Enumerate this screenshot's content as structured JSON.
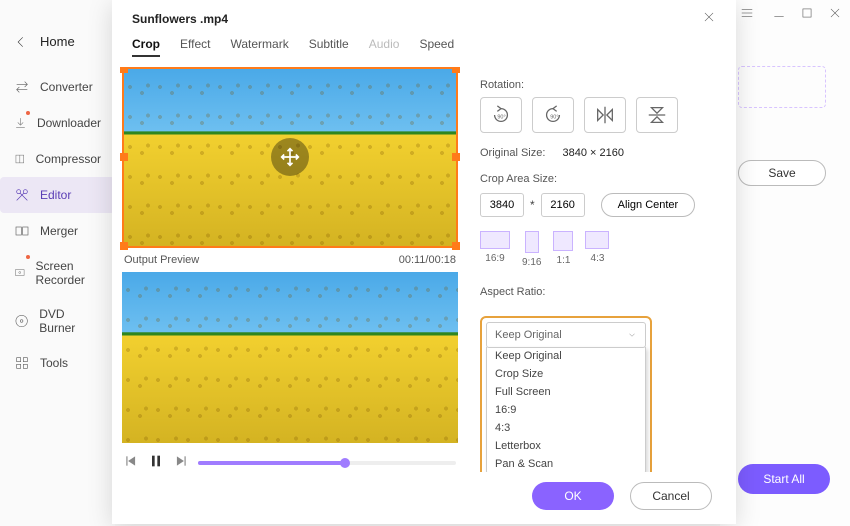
{
  "window": {
    "title": "Sunflowers .mp4"
  },
  "main_controls": {
    "menu": "menu",
    "min": "-",
    "max": "□",
    "close": "×"
  },
  "sidebar": {
    "home": "Home",
    "items": [
      {
        "label": "Converter",
        "icon": "converter"
      },
      {
        "label": "Downloader",
        "icon": "downloader"
      },
      {
        "label": "Compressor",
        "icon": "compressor"
      },
      {
        "label": "Editor",
        "icon": "editor",
        "active": true
      },
      {
        "label": "Merger",
        "icon": "merger"
      },
      {
        "label": "Screen Recorder",
        "icon": "screen-recorder"
      },
      {
        "label": "DVD Burner",
        "icon": "dvd-burner"
      },
      {
        "label": "Tools",
        "icon": "tools"
      }
    ]
  },
  "right_pane": {
    "save": "Save",
    "start_all": "Start All"
  },
  "tabs": [
    {
      "label": "Crop",
      "active": true
    },
    {
      "label": "Effect"
    },
    {
      "label": "Watermark"
    },
    {
      "label": "Subtitle"
    },
    {
      "label": "Audio",
      "disabled": true
    },
    {
      "label": "Speed"
    }
  ],
  "preview": {
    "label": "Output Preview",
    "time": "00:11/00:18"
  },
  "settings": {
    "rotation_label": "Rotation:",
    "original_size_label": "Original Size:",
    "original_size_value": "3840 × 2160",
    "crop_area_label": "Crop Area Size:",
    "crop_w": "3840",
    "crop_h": "2160",
    "times": "*",
    "align_center": "Align Center",
    "presets": [
      "16:9",
      "9:16",
      "1:1",
      "4:3"
    ],
    "aspect_label": "Aspect Ratio:",
    "aspect_selected": "Keep Original",
    "aspect_options": [
      "Keep Original",
      "Crop Size",
      "Full Screen",
      "16:9",
      "4:3",
      "Letterbox",
      "Pan & Scan"
    ]
  },
  "footer": {
    "ok": "OK",
    "cancel": "Cancel"
  }
}
